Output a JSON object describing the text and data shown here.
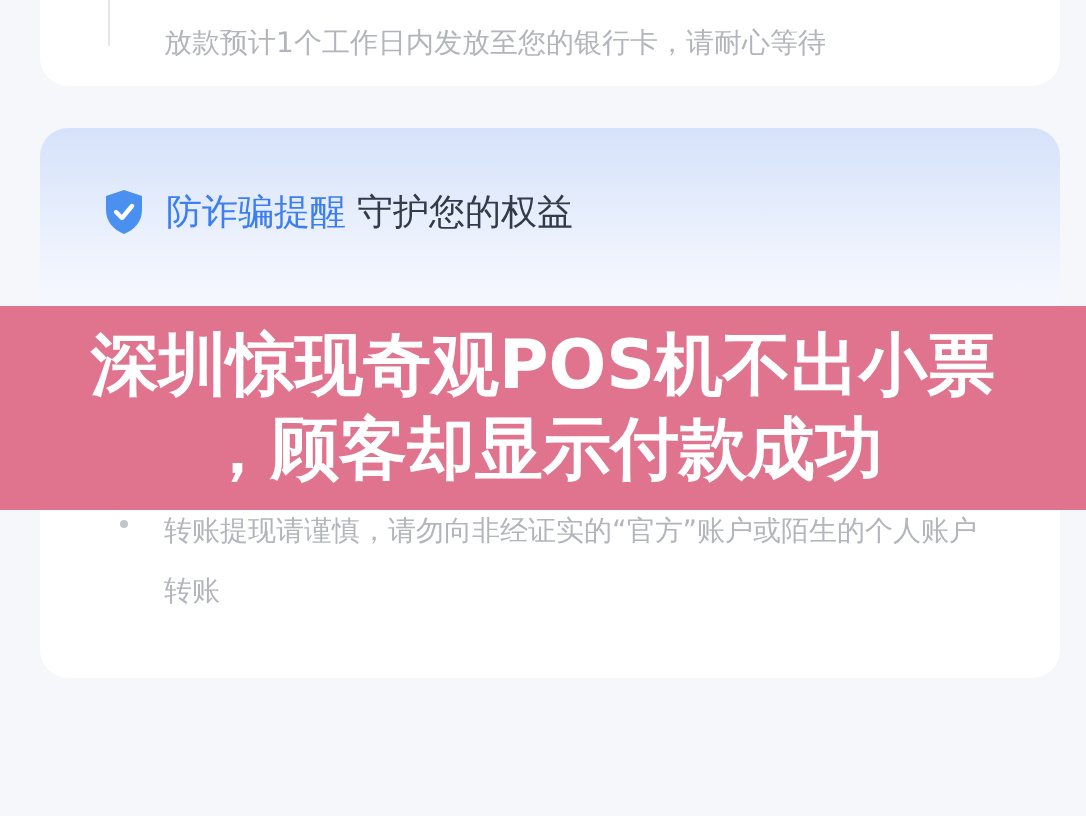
{
  "progress_card": {
    "text": "放款预计1个工作日内发放至您的银行卡，请耐心等待"
  },
  "notice": {
    "title_highlight": "防诈骗提醒",
    "title": "守护您的权益",
    "items": [
      {
        "text": "转账提现请谨慎，请勿向非经证实的“官方”账户或陌生的个人账户转账"
      }
    ]
  },
  "banner": {
    "lines": [
      "深圳惊现奇观POS机不出小票",
      "，顾客却显示付款成功"
    ]
  }
}
